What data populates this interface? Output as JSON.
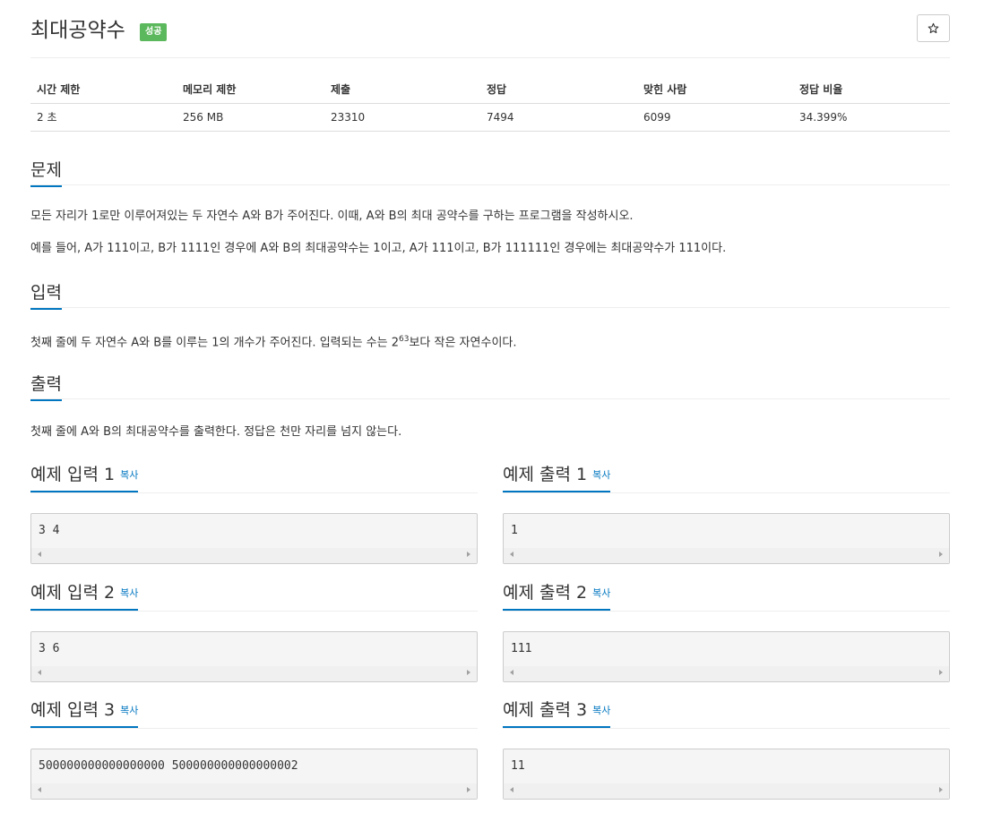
{
  "problem": {
    "title": "최대공약수",
    "badge": "성공",
    "star_icon": "star-icon"
  },
  "stats": {
    "headers": [
      "시간 제한",
      "메모리 제한",
      "제출",
      "정답",
      "맞힌 사람",
      "정답 비율"
    ],
    "values": [
      "2 초",
      "256 MB",
      "23310",
      "7494",
      "6099",
      "34.399%"
    ]
  },
  "sections": {
    "problem": {
      "title": "문제",
      "p1": "모든 자리가 1로만 이루어져있는 두 자연수 A와 B가 주어진다. 이때, A와 B의 최대 공약수를 구하는 프로그램을 작성하시오.",
      "p2": "예를 들어, A가 111이고, B가 1111인 경우에 A와 B의 최대공약수는 1이고, A가 111이고, B가 111111인 경우에는 최대공약수가 111이다."
    },
    "input": {
      "title": "입력",
      "p1_before": "첫째 줄에 두 자연수 A와 B를 이루는 1의 개수가 주어진다. 입력되는 수는 2",
      "p1_sup": "63",
      "p1_after": "보다 작은 자연수이다."
    },
    "output": {
      "title": "출력",
      "p1": "첫째 줄에 A와 B의 최대공약수를 출력한다. 정답은 천만 자리를 넘지 않는다."
    }
  },
  "samples": {
    "copy_label": "복사",
    "items": [
      {
        "in_title": "예제 입력 1",
        "in_value": "3 4",
        "out_title": "예제 출력 1",
        "out_value": "1"
      },
      {
        "in_title": "예제 입력 2",
        "in_value": "3 6",
        "out_title": "예제 출력 2",
        "out_value": "111"
      },
      {
        "in_title": "예제 입력 3",
        "in_value": "500000000000000000 500000000000000002",
        "out_title": "예제 출력 3",
        "out_value": "11"
      }
    ]
  },
  "colors": {
    "accent": "#0076c0",
    "badge_success": "#5cb85c"
  }
}
